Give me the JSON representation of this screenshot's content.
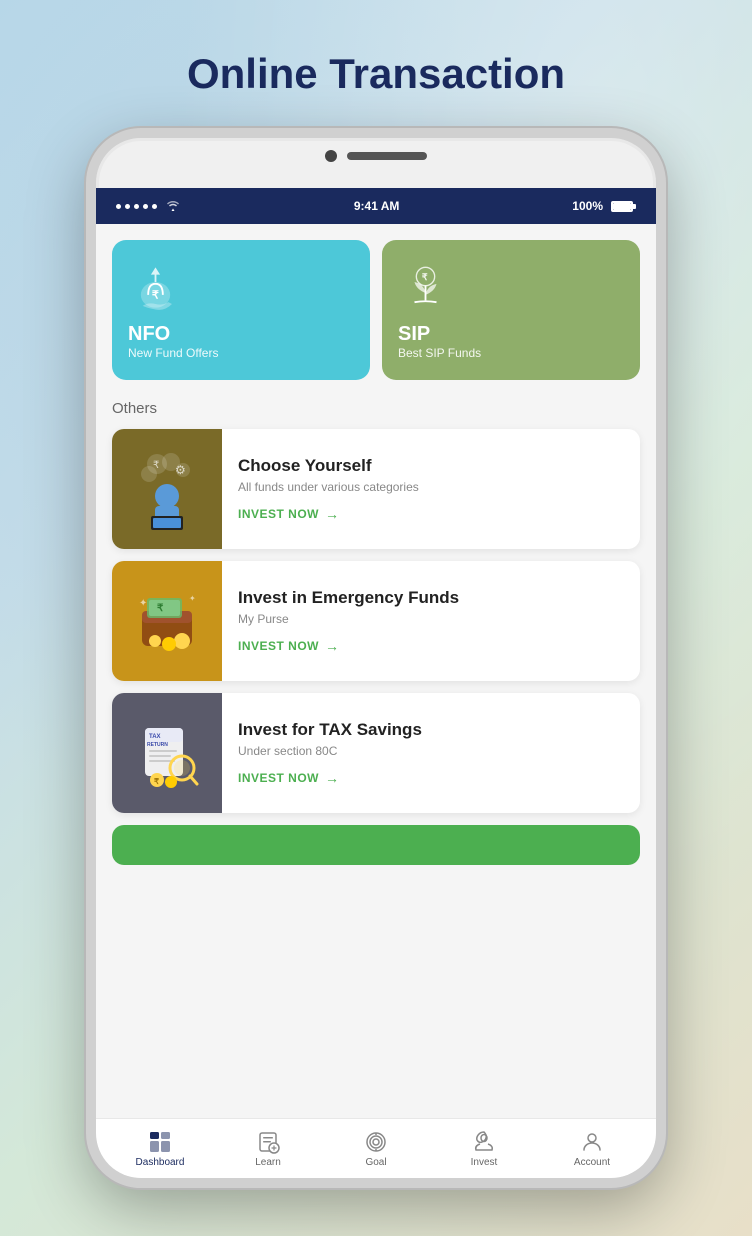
{
  "page": {
    "title": "Online Transaction"
  },
  "status_bar": {
    "time": "9:41 AM",
    "battery": "100%"
  },
  "top_cards": [
    {
      "id": "nfo",
      "title": "NFO",
      "subtitle": "New Fund Offers",
      "color": "#4dc8d8"
    },
    {
      "id": "sip",
      "title": "SIP",
      "subtitle": "Best SIP Funds",
      "color": "#8fae6a"
    }
  ],
  "others_label": "Others",
  "list_items": [
    {
      "id": "choose-yourself",
      "title": "Choose Yourself",
      "desc": "All funds under various categories",
      "cta": "INVEST NOW",
      "image_color": "dark-olive"
    },
    {
      "id": "emergency-funds",
      "title": "Invest in Emergency Funds",
      "desc": "My Purse",
      "cta": "INVEST NOW",
      "image_color": "golden"
    },
    {
      "id": "tax-savings",
      "title": "Invest for TAX Savings",
      "desc": "Under section 80C",
      "cta": "INVEST NOW",
      "image_color": "dark-gray"
    }
  ],
  "bottom_nav": [
    {
      "id": "dashboard",
      "label": "Dashboard",
      "active": true
    },
    {
      "id": "learn",
      "label": "Learn",
      "active": false
    },
    {
      "id": "goal",
      "label": "Goal",
      "active": false
    },
    {
      "id": "invest",
      "label": "Invest",
      "active": false
    },
    {
      "id": "account",
      "label": "Account",
      "active": false
    }
  ]
}
